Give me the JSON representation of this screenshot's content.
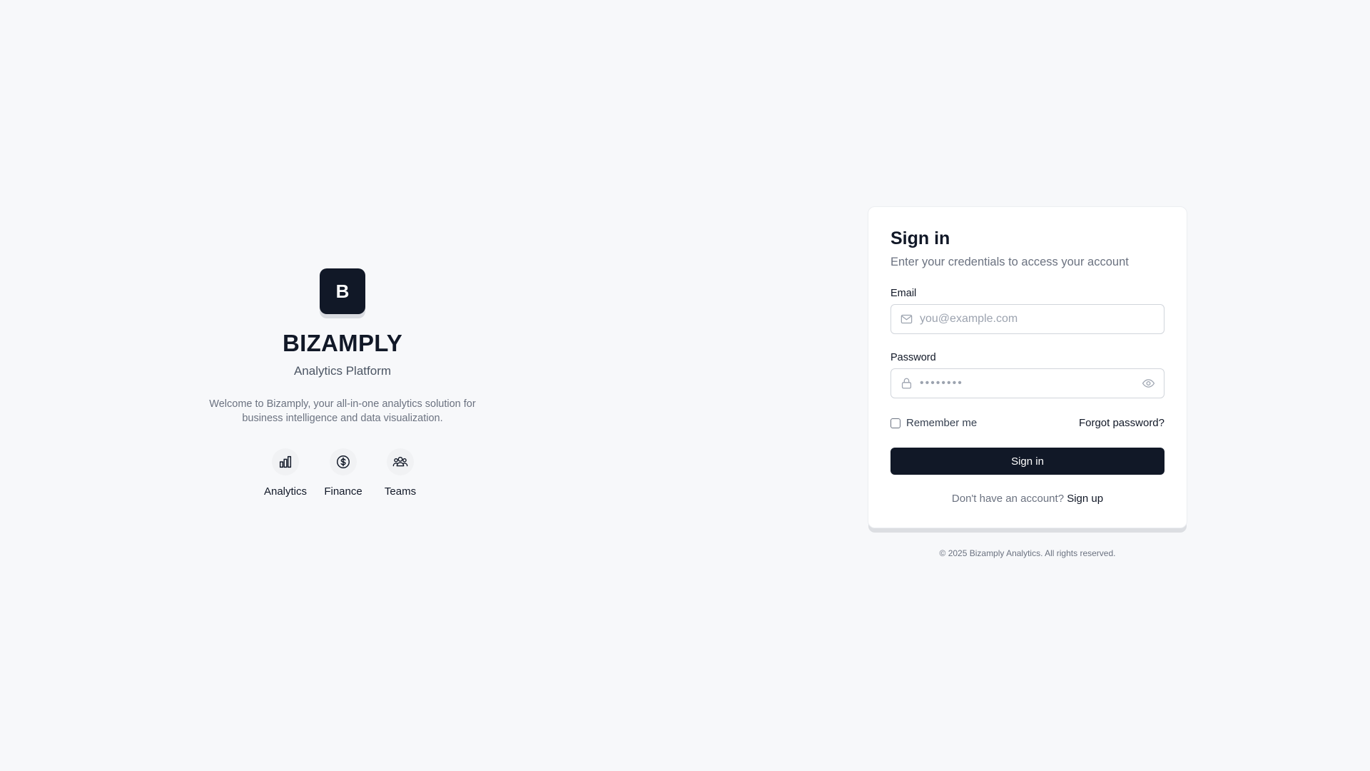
{
  "brand": {
    "logo_letter": "B",
    "name": "BIZAMPLY",
    "subtitle": "Analytics Platform",
    "description": "Welcome to Bizamply, your all-in-one analytics solution for business intelligence and data visualization.",
    "features": [
      {
        "label": "Analytics",
        "icon": "bar-chart-icon"
      },
      {
        "label": "Finance",
        "icon": "dollar-circle-icon"
      },
      {
        "label": "Teams",
        "icon": "users-icon"
      }
    ]
  },
  "signin": {
    "title": "Sign in",
    "subtitle": "Enter your credentials to access your account",
    "email_label": "Email",
    "email_placeholder": "you@example.com",
    "email_value": "",
    "password_label": "Password",
    "password_placeholder": "••••••••",
    "password_value": "",
    "remember_label": "Remember me",
    "remember_checked": false,
    "forgot_label": "Forgot password?",
    "submit_label": "Sign in",
    "no_account_text": "Don't have an account?",
    "signup_label": "Sign up"
  },
  "footer": {
    "copyright": "© 2025 Bizamply Analytics. All rights reserved."
  },
  "colors": {
    "background": "#f7f8fa",
    "primary": "#111827",
    "muted_text": "#6b7280",
    "border": "#d1d5db"
  }
}
